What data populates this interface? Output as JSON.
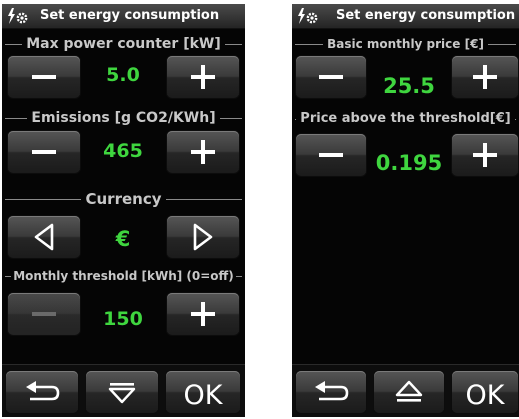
{
  "colors": {
    "value_green": "#3fd63f",
    "section_label": "#c8c8c8",
    "icon_white": "#ffffff"
  },
  "left_screen": {
    "title": "Set energy consumption",
    "title_icon": "energy-gear-icon",
    "max_power": {
      "label": "Max power counter [kW]",
      "value": "5.0",
      "decrement_icon": "minus-icon",
      "increment_icon": "plus-icon"
    },
    "emissions": {
      "label": "Emissions [g CO2/KWh]",
      "value": "465",
      "decrement_icon": "minus-icon",
      "increment_icon": "plus-icon"
    },
    "currency": {
      "label": "Currency",
      "value": "€",
      "prev_icon": "triangle-left-icon",
      "next_icon": "triangle-right-icon"
    },
    "threshold": {
      "label": "Monthly threshold [kWh] (0=off)",
      "value": "150",
      "decrement_icon": "minus-icon",
      "increment_icon": "plus-icon"
    },
    "bottom": {
      "back_icon": "back-arrow-icon",
      "scroll_icon": "triangle-down-icon",
      "ok_label": "OK"
    }
  },
  "right_screen": {
    "title": "Set energy consumption",
    "title_icon": "energy-gear-icon",
    "basic_price": {
      "label": "Basic monthly price [€]",
      "value": "25.5",
      "decrement_icon": "minus-icon",
      "increment_icon": "plus-icon"
    },
    "price_above": {
      "label": "Price above the threshold[€]",
      "value": "0.195",
      "decrement_icon": "minus-icon",
      "increment_icon": "plus-icon"
    },
    "bottom": {
      "back_icon": "back-arrow-icon",
      "scroll_icon": "triangle-up-icon",
      "ok_label": "OK"
    }
  }
}
